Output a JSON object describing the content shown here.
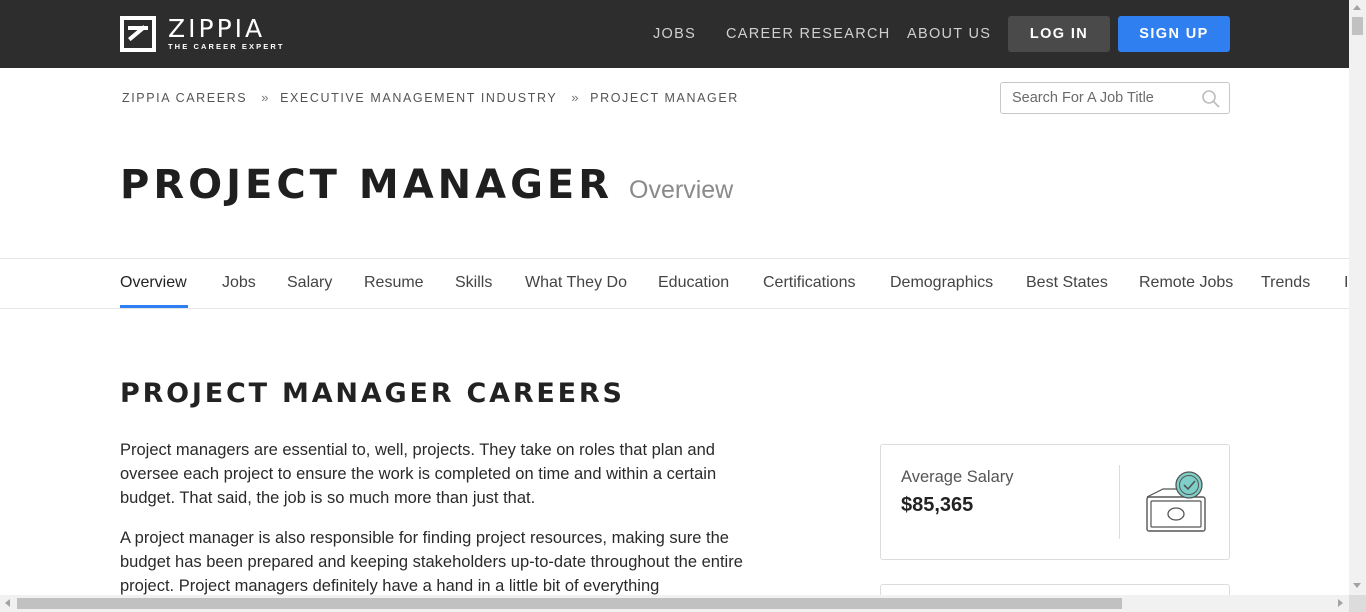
{
  "header": {
    "logo_name": "ZIPPIA",
    "logo_tagline": "THE CAREER EXPERT",
    "nav": [
      "JOBS",
      "CAREER RESEARCH",
      "ABOUT US"
    ],
    "login_label": "LOG IN",
    "signup_label": "SIGN UP",
    "colors": {
      "background": "#2d2d2d",
      "login": "#4a4a4a",
      "signup": "#2f7ff0"
    }
  },
  "breadcrumb": [
    "ZIPPIA CAREERS",
    "EXECUTIVE MANAGEMENT INDUSTRY",
    "PROJECT MANAGER"
  ],
  "breadcrumb_separator": "»",
  "search": {
    "placeholder": "Search For A Job Title",
    "icon": "search-icon"
  },
  "title": {
    "main": "PROJECT MANAGER",
    "subtitle": "Overview"
  },
  "tabs": {
    "items": [
      "Overview",
      "Jobs",
      "Salary",
      "Resume",
      "Skills",
      "What They Do",
      "Education",
      "Certifications",
      "Demographics",
      "Best States",
      "Remote Jobs",
      "Trends"
    ],
    "active": "Overview",
    "accent": "#2f7ff0"
  },
  "section": {
    "title": "PROJECT MANAGER CAREERS",
    "para1": "Project managers are essential to, well, projects. They take on roles that plan and oversee each project to ensure the work is completed on time and within a certain budget. That said, the job is so much more than just that.",
    "para2": "A project manager is also responsible for finding project resources, making sure the budget has been prepared and keeping stakeholders up-to-date throughout the entire project. Project managers definitely have a hand in a little bit of everything"
  },
  "salary_card": {
    "label": "Average Salary",
    "value": "$85,365",
    "icon": "money-coin-icon"
  }
}
